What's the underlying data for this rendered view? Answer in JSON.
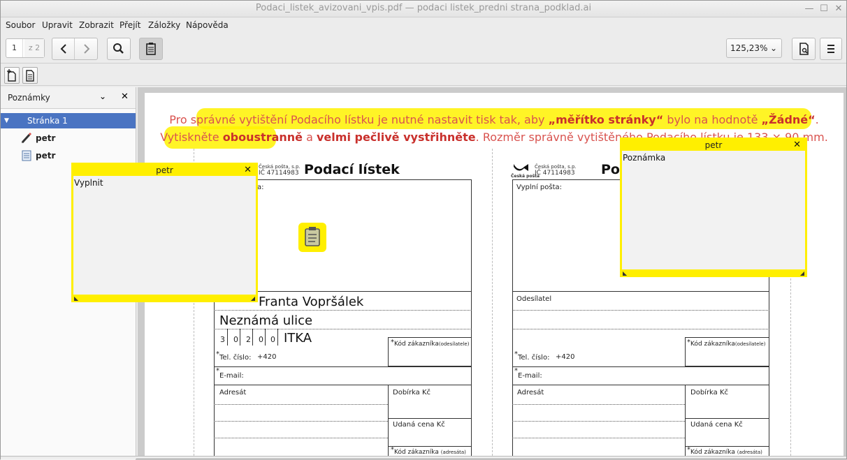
{
  "window": {
    "title": "Podaci_listek_avizovani_vpis.pdf — podaci listek_predni strana_podklad.ai"
  },
  "menu": [
    "Soubor",
    "Upravit",
    "Zobrazit",
    "Přejít",
    "Záložky",
    "Nápověda"
  ],
  "toolbar": {
    "current_page": "1",
    "total_pages": "z 2",
    "zoom": "125,23%"
  },
  "sidebar": {
    "title": "Poznámky",
    "page_label": "Stránka 1",
    "annotations": [
      {
        "author": "petr",
        "icon": "pencil-icon"
      },
      {
        "author": "petr",
        "icon": "note-icon"
      }
    ]
  },
  "document": {
    "instruction_line1_a": "Pro správné vytištění Podacího lístku je nutné nastavit tisk tak, aby ",
    "instruction_line1_b": "„měřítko stránky“",
    "instruction_line1_c": " bylo na hodnotě ",
    "instruction_line1_d": "„Žádné“",
    "instruction_line1_e": ".",
    "instruction_line2_a": "Vytiskněte ",
    "instruction_line2_b": "oboustranně",
    "instruction_line2_c": " a ",
    "instruction_line2_d": "velmi pečlivě vystřihněte",
    "instruction_line2_e": ". Rozměr správně vytištěného Podacího lístku je 133 × 90 mm.",
    "form_title": "Podací lístek",
    "form_title_right": "Po",
    "post_name": "Česká pošta, s.p.",
    "ic": "IČ 47114983",
    "post_logo_text": "Česká pošta",
    "vyplni_posta": "Vyplní pošta:",
    "odesilatel": "Odesílatel",
    "sender_name": "Franta Vopršálek",
    "sender_street": "Neznámá ulice",
    "zip_digits": [
      "3",
      "0",
      "2",
      "0",
      "0"
    ],
    "sender_city": "ITKA",
    "kod_zakaznika_odes": "Kód zákazníka",
    "kod_zakaznika_odes_small": "(odesílatele)",
    "tel": "Tel. číslo:",
    "tel_prefix": "+420",
    "email": "E-mail:",
    "adresat": "Adresát",
    "dobirka": "Dobírka Kč",
    "udana_cena": "Udaná cena Kč",
    "kod_zakaznika_adr": "Kód zákazníka",
    "kod_zakaznika_adr_small": "(adresáta)",
    "star": "*"
  },
  "popups": [
    {
      "author": "petr",
      "text": "Vyplnit"
    },
    {
      "author": "petr",
      "text": "Poznámka"
    }
  ],
  "colors": {
    "highlight": "#fff200",
    "selection": "#4a74c2",
    "instruction": "#d9534f"
  }
}
